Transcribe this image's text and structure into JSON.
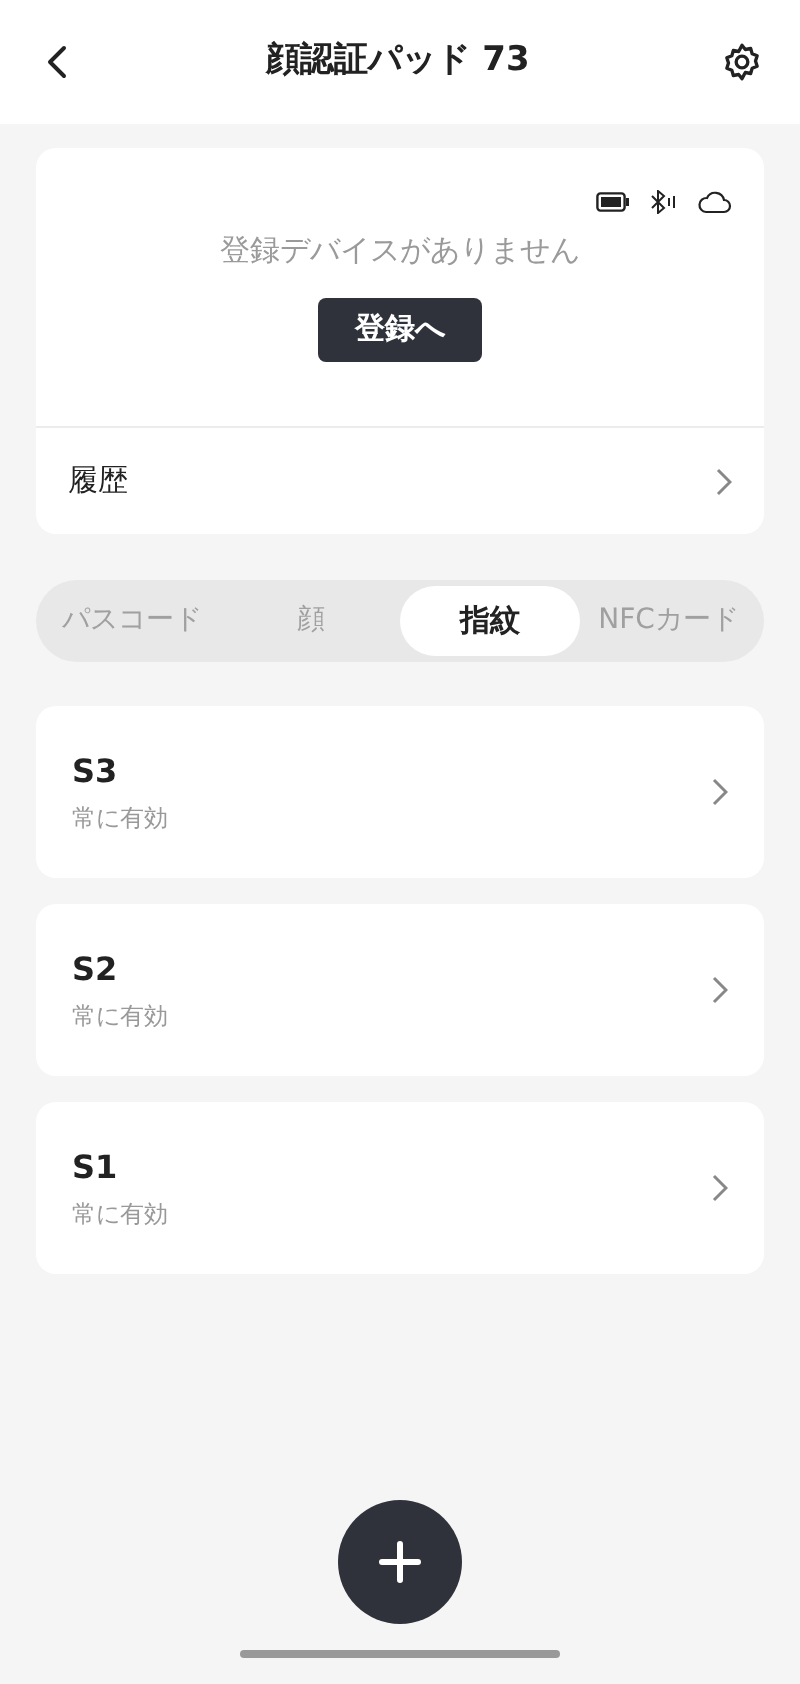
{
  "header": {
    "title": "顔認証パッド 73"
  },
  "device_card": {
    "message": "登録デバイスがありません",
    "button": "登録へ",
    "history": "履歴"
  },
  "tabs": [
    {
      "label": "パスコード",
      "selected": false
    },
    {
      "label": "顔",
      "selected": false
    },
    {
      "label": "指紋",
      "selected": true
    },
    {
      "label": "NFCカード",
      "selected": false
    }
  ],
  "items": [
    {
      "name": "S3",
      "validity": "常に有効"
    },
    {
      "name": "S2",
      "validity": "常に有効"
    },
    {
      "name": "S1",
      "validity": "常に有効"
    }
  ]
}
